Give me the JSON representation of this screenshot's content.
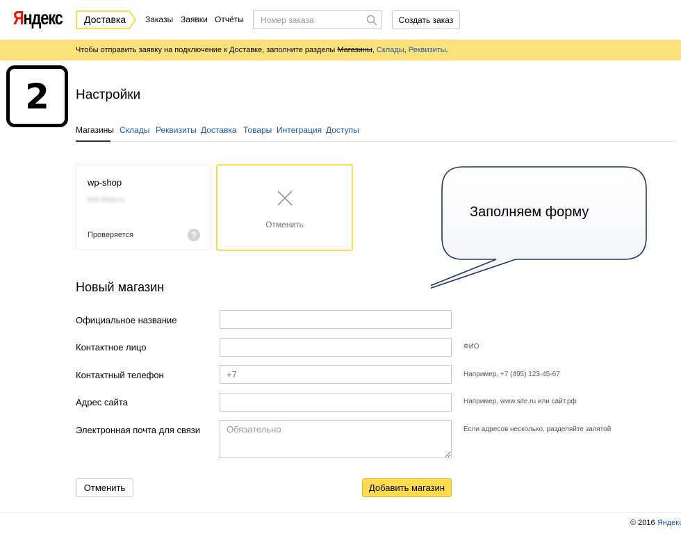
{
  "header": {
    "logo_first": "Я",
    "logo_rest": "ндекс",
    "service": "Доставка",
    "nav": [
      "Заказы",
      "Заявки",
      "Отчёты"
    ],
    "search_placeholder": "Номер заказа",
    "create_button": "Создать заказ"
  },
  "notice": {
    "text": "Чтобы отправить заявку на подключение к Доставке, заполните разделы",
    "done_section": "Магазины",
    "sep1": ",",
    "link1": "Склады",
    "sep2": ",",
    "link2": "Реквизиты",
    "end": "."
  },
  "step_badge": "2",
  "page_title": "Настройки",
  "tabs": [
    "Магазины",
    "Склады",
    "Реквизиты",
    "Доставка",
    "Товары",
    "Интеграция",
    "Доступы"
  ],
  "store_card": {
    "name": "wp-shop",
    "domain": "test-shop.ru",
    "status": "Проверяется",
    "help_icon": "?"
  },
  "cancel_card": {
    "label": "Отменить"
  },
  "callout": {
    "text": "Заполняем форму"
  },
  "form": {
    "title": "Новый магазин",
    "fields": [
      {
        "label": "Официальное название",
        "value": "",
        "placeholder": "",
        "hint": ""
      },
      {
        "label": "Контактное лицо",
        "value": "",
        "placeholder": "",
        "hint": "ФИО"
      },
      {
        "label": "Контактный телефон",
        "value": "+7",
        "placeholder": "",
        "hint": "Например, +7 (495) 123-45-67"
      },
      {
        "label": "Адрес сайта",
        "value": "",
        "placeholder": "",
        "hint": "Например, www.site.ru или сайт.рф"
      },
      {
        "label": "Электронная почта для связи",
        "value": "",
        "placeholder": "Обязательно",
        "hint": "Если адресов несколько, разделяйте запятой"
      }
    ],
    "cancel_button": "Отменить",
    "submit_button": "Добавить магазин"
  },
  "footer": {
    "copyright": "© 2016",
    "link": "Яндекс"
  },
  "colors": {
    "accent_yellow": "#ffdb4d",
    "notice_bg": "#fce27b",
    "link_blue": "#1d5ab3",
    "logo_red": "#e61400"
  }
}
